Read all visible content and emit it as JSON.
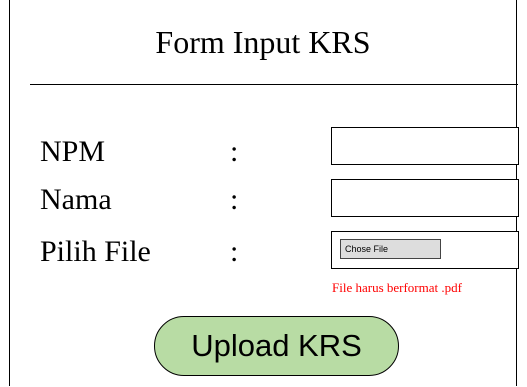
{
  "form": {
    "title": "Form Input KRS",
    "fields": [
      {
        "label": "NPM",
        "separator": ":",
        "value": ""
      },
      {
        "label": "Nama",
        "separator": ":",
        "value": ""
      },
      {
        "label": "Pilih File",
        "separator": ":",
        "button_label": "Chose File"
      }
    ],
    "file_hint": "File harus berformat .pdf",
    "submit_label": "Upload KRS"
  },
  "colors": {
    "upload_button_bg": "#b8dca4",
    "hint_text": "#ff0000",
    "file_button_bg": "#dddddd"
  }
}
